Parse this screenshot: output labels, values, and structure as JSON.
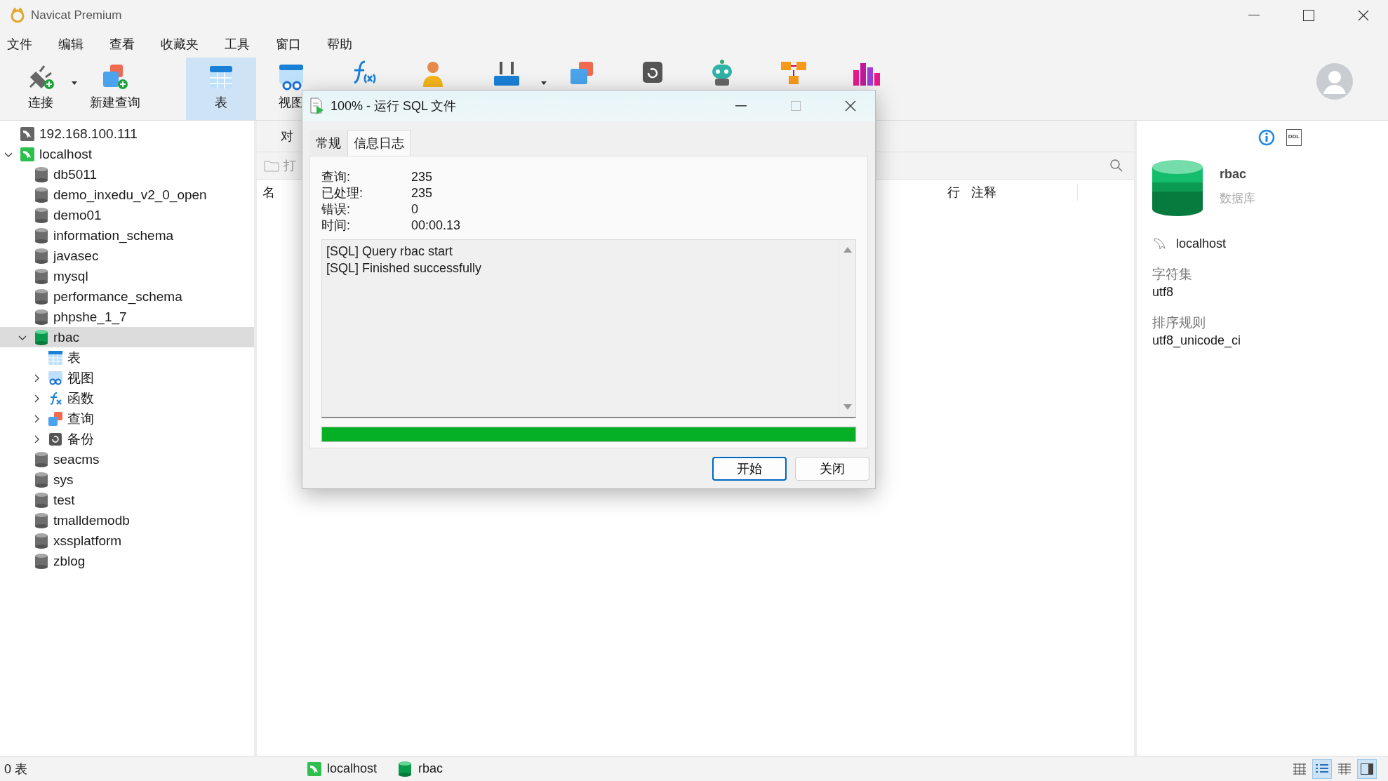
{
  "window": {
    "title": "Navicat Premium"
  },
  "menu": [
    "文件",
    "编辑",
    "查看",
    "收藏夹",
    "工具",
    "窗口",
    "帮助"
  ],
  "toolbar": [
    {
      "kind": "connect",
      "label": "连接",
      "selected": false,
      "dropdown": true
    },
    {
      "kind": "new-query",
      "label": "新建查询",
      "selected": false
    },
    {
      "kind": "table",
      "label": "表",
      "selected": true
    },
    {
      "kind": "view",
      "label": "视图",
      "selected": false
    },
    {
      "kind": "function",
      "selected": false
    },
    {
      "kind": "user",
      "selected": false
    },
    {
      "kind": "tools",
      "selected": false,
      "dropdown": true
    },
    {
      "kind": "query",
      "selected": false
    },
    {
      "kind": "backup",
      "selected": false
    },
    {
      "kind": "automation",
      "selected": false
    },
    {
      "kind": "model",
      "selected": false
    },
    {
      "kind": "chart",
      "selected": false
    }
  ],
  "tree": [
    {
      "kind": "connection",
      "open": false,
      "label": "192.168.100.111",
      "selected": false
    },
    {
      "kind": "connection",
      "open": true,
      "label": "localhost",
      "selected": false,
      "expanded": true,
      "children": [
        {
          "kind": "database",
          "open": false,
          "label": "db5011",
          "selected": false
        },
        {
          "kind": "database",
          "open": false,
          "label": "demo_inxedu_v2_0_open",
          "selected": false
        },
        {
          "kind": "database",
          "open": false,
          "label": "demo01",
          "selected": false
        },
        {
          "kind": "database",
          "open": false,
          "label": "information_schema",
          "selected": false
        },
        {
          "kind": "database",
          "open": false,
          "label": "javasec",
          "selected": false
        },
        {
          "kind": "database",
          "open": false,
          "label": "mysql",
          "selected": false
        },
        {
          "kind": "database",
          "open": false,
          "label": "performance_schema",
          "selected": false
        },
        {
          "kind": "database",
          "open": false,
          "label": "phpshe_1_7",
          "selected": false
        },
        {
          "kind": "database",
          "open": true,
          "label": "rbac",
          "selected": true,
          "expanded": true,
          "children": [
            {
              "kind": "tables",
              "label": "表",
              "selected": false
            },
            {
              "kind": "views",
              "label": "视图",
              "selected": false,
              "expanded": false
            },
            {
              "kind": "functions",
              "label": "函数",
              "selected": false,
              "expanded": false
            },
            {
              "kind": "queries",
              "label": "查询",
              "selected": false,
              "expanded": false
            },
            {
              "kind": "backups",
              "label": "备份",
              "selected": false,
              "expanded": false
            }
          ]
        },
        {
          "kind": "database",
          "open": false,
          "label": "seacms",
          "selected": false
        },
        {
          "kind": "database",
          "open": false,
          "label": "sys",
          "selected": false
        },
        {
          "kind": "database",
          "open": false,
          "label": "test",
          "selected": false
        },
        {
          "kind": "database",
          "open": false,
          "label": "tmalldemodb",
          "selected": false
        },
        {
          "kind": "database",
          "open": false,
          "label": "xssplatform",
          "selected": false
        },
        {
          "kind": "database",
          "open": false,
          "label": "zblog",
          "selected": false
        }
      ]
    }
  ],
  "content": {
    "tab": "对",
    "open_button": "打",
    "columns": [
      "名",
      "行",
      "注释"
    ]
  },
  "info_panel": {
    "ddl": "DDL",
    "name": "rbac",
    "type": "数据库",
    "connection": "localhost",
    "fields": [
      {
        "label": "字符集",
        "value": "utf8"
      },
      {
        "label": "排序规则",
        "value": "utf8_unicode_ci"
      }
    ]
  },
  "dialog": {
    "title": "100% - 运行 SQL 文件",
    "tabs": [
      {
        "label": "常规",
        "selected": false
      },
      {
        "label": "信息日志",
        "selected": true
      }
    ],
    "stats": [
      {
        "label": "查询:",
        "value": "235"
      },
      {
        "label": "已处理:",
        "value": "235"
      },
      {
        "label": "错误:",
        "value": "0"
      },
      {
        "label": "时间:",
        "value": "00:00.13"
      }
    ],
    "log": [
      "[SQL] Query rbac start",
      "[SQL] Finished successfully"
    ],
    "progress": {
      "level": 1
    },
    "buttons": [
      {
        "label": "开始",
        "primary": true
      },
      {
        "label": "关闭",
        "primary": false
      }
    ]
  },
  "status_bar": {
    "count": "0 表",
    "connection": "localhost",
    "database": "rbac",
    "views": [
      {
        "kind": "grid",
        "selected": false
      },
      {
        "kind": "list",
        "selected": true
      },
      {
        "kind": "detail",
        "selected": false
      },
      {
        "kind": "panel",
        "selected": true
      }
    ]
  }
}
